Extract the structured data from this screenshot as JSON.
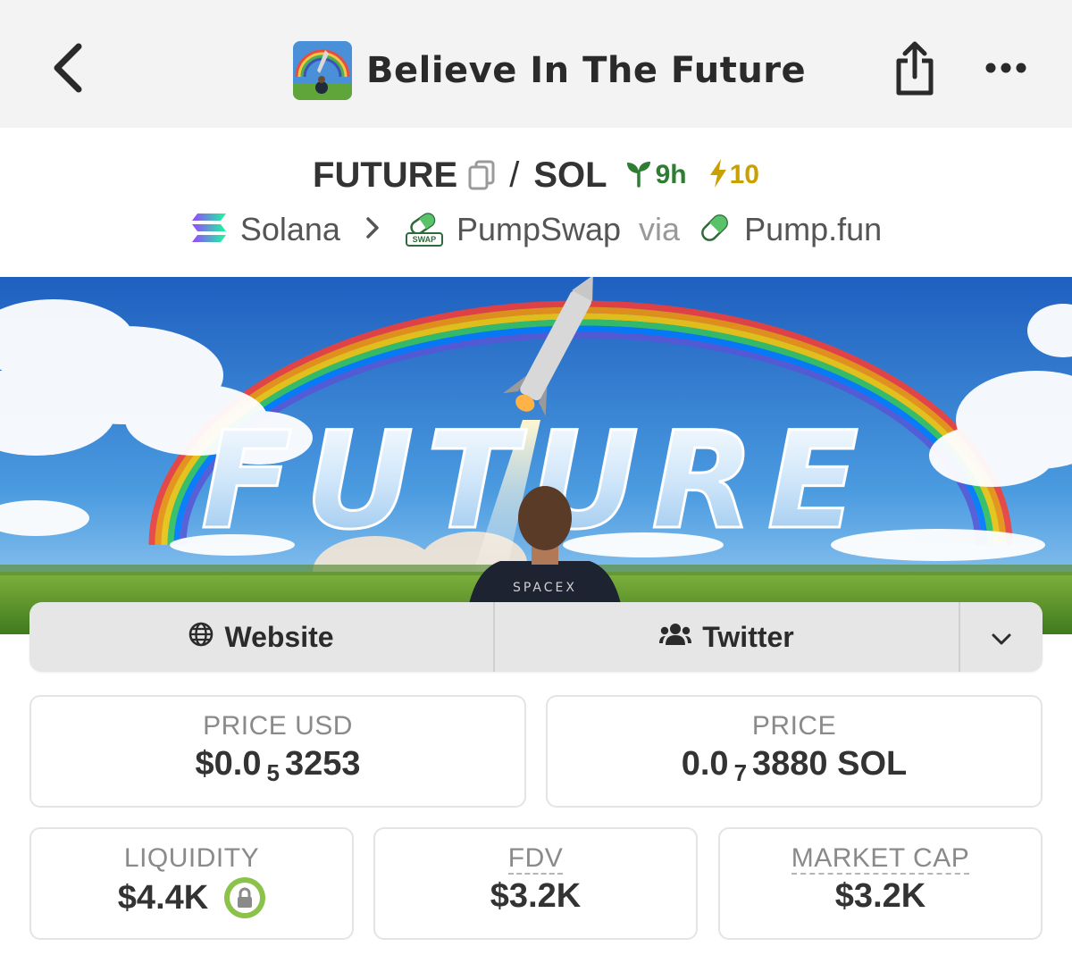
{
  "header": {
    "title": "Believe In The Future",
    "back_icon": "chevron-left-icon",
    "share_icon": "share-icon",
    "more_icon": "more-dots-icon"
  },
  "pair": {
    "base": "FUTURE",
    "separator": "/",
    "quote": "SOL",
    "age": "9h",
    "boosts": "10",
    "age_color": "#2e7d32",
    "boost_color": "#c9a000"
  },
  "chain_path": {
    "chain": "Solana",
    "dex": "PumpSwap",
    "dex_badge": "SWAP",
    "via": "via",
    "launchpad": "Pump.fun"
  },
  "banner": {
    "headline": "FUTURE",
    "jacket_text": "SPACEX"
  },
  "links": {
    "website": "Website",
    "twitter": "Twitter"
  },
  "stats": {
    "price_usd": {
      "label": "PRICE USD",
      "prefix": "$0.0",
      "zeros": "5",
      "digits": "3253"
    },
    "price_native": {
      "label": "PRICE",
      "prefix": "0.0",
      "zeros": "7",
      "digits": "3880 SOL"
    },
    "liquidity": {
      "label": "LIQUIDITY",
      "value": "$4.4K"
    },
    "fdv": {
      "label": "FDV",
      "value": "$3.2K"
    },
    "market_cap": {
      "label": "MARKET CAP",
      "value": "$3.2K"
    }
  }
}
